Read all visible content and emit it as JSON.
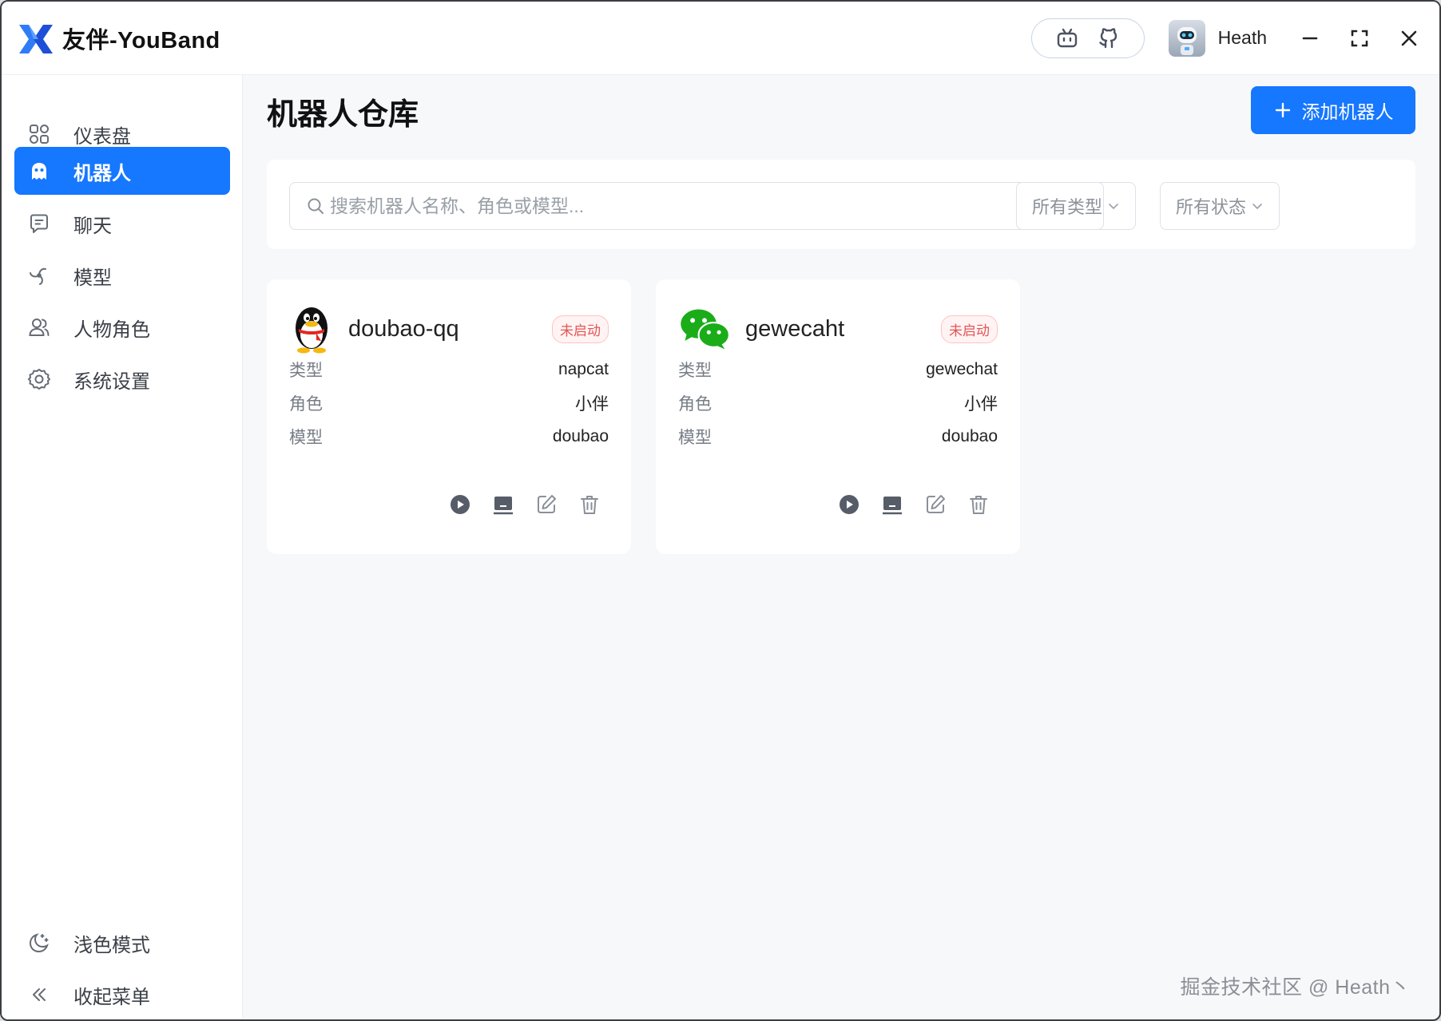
{
  "app": {
    "title": "友伴-YouBand"
  },
  "header": {
    "user_name": "Heath",
    "link_icons": [
      "bilibili-icon",
      "github-icon"
    ],
    "window_controls": [
      "minimize-icon",
      "maximize-icon",
      "close-icon"
    ]
  },
  "sidebar": {
    "items": [
      {
        "label": "仪表盘",
        "icon": "dashboard-icon",
        "active": false
      },
      {
        "label": "机器人",
        "icon": "robot-icon",
        "active": true
      },
      {
        "label": "聊天",
        "icon": "chat-icon",
        "active": false
      },
      {
        "label": "模型",
        "icon": "model-icon",
        "active": false
      },
      {
        "label": "人物角色",
        "icon": "persona-icon",
        "active": false
      },
      {
        "label": "系统设置",
        "icon": "settings-icon",
        "active": false
      }
    ],
    "bottom": [
      {
        "label": "浅色模式",
        "icon": "theme-toggle-icon"
      },
      {
        "label": "收起菜单",
        "icon": "collapse-icon"
      }
    ]
  },
  "main": {
    "title": "机器人仓库",
    "add_button": "添加机器人",
    "search_placeholder": "搜索机器人名称、角色或模型...",
    "filters": {
      "type": "所有类型",
      "status": "所有状态"
    }
  },
  "bots": [
    {
      "name": "doubao-qq",
      "logo": "qq-penguin-icon",
      "status": "未启动",
      "fields": [
        {
          "key": "类型",
          "value": "napcat"
        },
        {
          "key": "角色",
          "value": "小伴"
        },
        {
          "key": "模型",
          "value": "doubao"
        }
      ]
    },
    {
      "name": "gewecaht",
      "logo": "wechat-icon",
      "status": "未启动",
      "fields": [
        {
          "key": "类型",
          "value": "gewechat"
        },
        {
          "key": "角色",
          "value": "小伴"
        },
        {
          "key": "模型",
          "value": "doubao"
        }
      ]
    }
  ],
  "watermark": "掘金技术社区 @ Heath丶",
  "colors": {
    "accent": "#1677ff",
    "status_stopped": "#e35555",
    "background": "#f7f8fa"
  }
}
